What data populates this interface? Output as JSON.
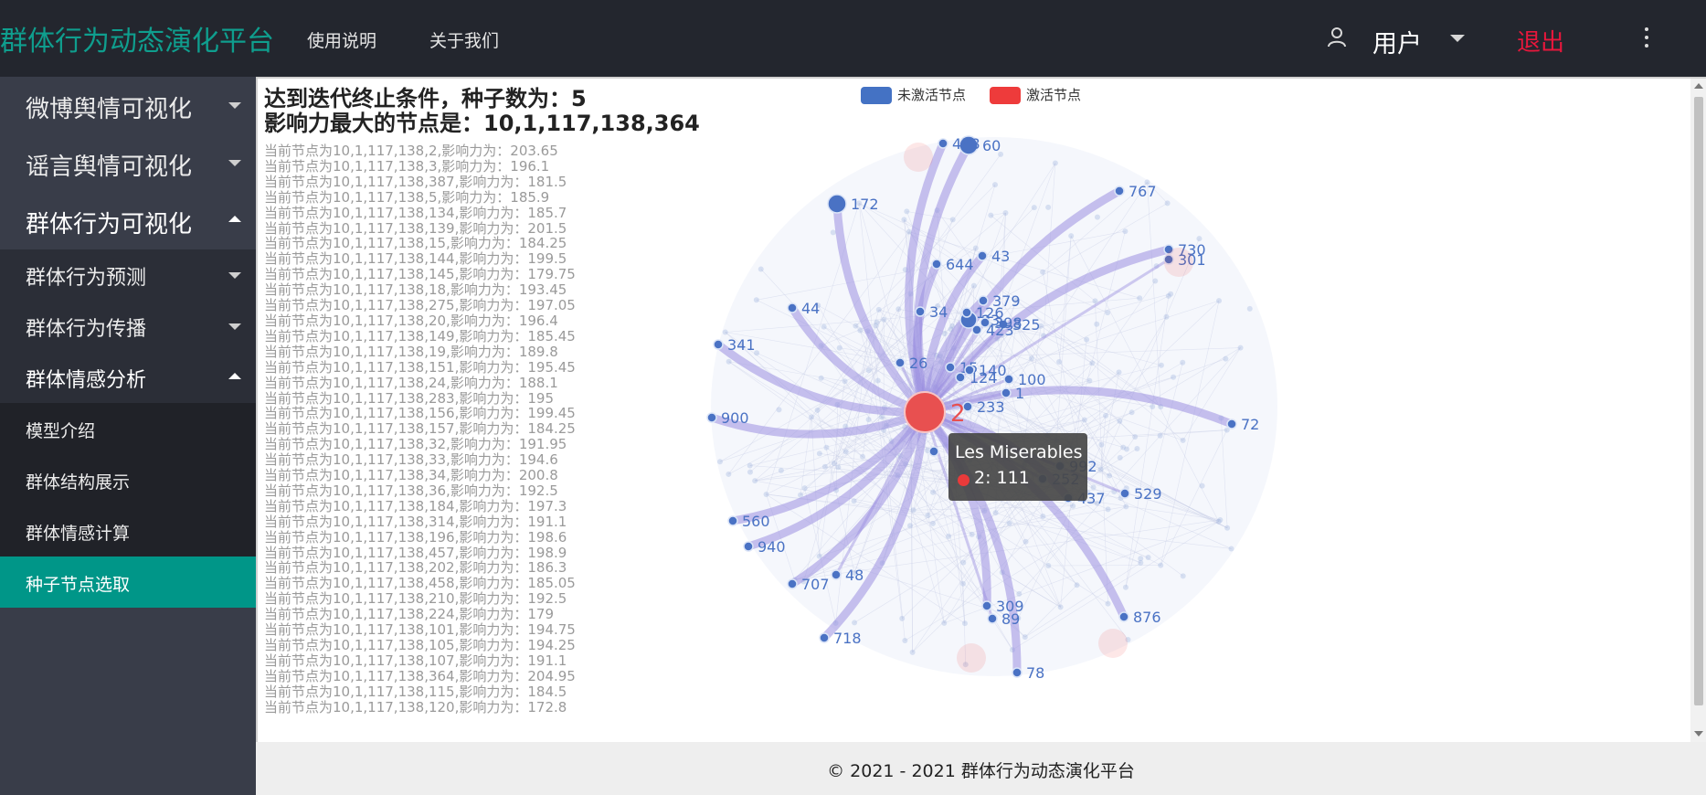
{
  "header": {
    "brand": "群体行为动态演化平台",
    "nav": [
      "使用说明",
      "关于我们"
    ],
    "user_label": "用户",
    "logout_label": "退出"
  },
  "sidebar": {
    "items": [
      {
        "label": "微博舆情可视化",
        "level": 1,
        "expanded": false
      },
      {
        "label": "谣言舆情可视化",
        "level": 1,
        "expanded": false
      },
      {
        "label": "群体行为可视化",
        "level": 1,
        "expanded": true
      },
      {
        "label": "群体行为预测",
        "level": 2,
        "expanded": false
      },
      {
        "label": "群体行为传播",
        "level": 2,
        "expanded": false
      },
      {
        "label": "群体情感分析",
        "level": 2,
        "expanded": true
      },
      {
        "label": "模型介绍",
        "level": 3
      },
      {
        "label": "群体结构展示",
        "level": 3
      },
      {
        "label": "群体情感计算",
        "level": 3
      },
      {
        "label": "种子节点选取",
        "level": 3,
        "active": true
      }
    ]
  },
  "result": {
    "line1": "达到迭代终止条件，种子数为：5",
    "line2": "影响力最大的节点是：10,1,117,138,364",
    "log": [
      "当前节点为10,1,117,138,2,影响力为：203.65",
      "当前节点为10,1,117,138,3,影响力为：196.1",
      "当前节点为10,1,117,138,387,影响力为：181.5",
      "当前节点为10,1,117,138,5,影响力为：185.9",
      "当前节点为10,1,117,138,134,影响力为：185.7",
      "当前节点为10,1,117,138,139,影响力为：201.5",
      "当前节点为10,1,117,138,15,影响力为：184.25",
      "当前节点为10,1,117,138,144,影响力为：199.5",
      "当前节点为10,1,117,138,145,影响力为：179.75",
      "当前节点为10,1,117,138,18,影响力为：193.45",
      "当前节点为10,1,117,138,275,影响力为：197.05",
      "当前节点为10,1,117,138,20,影响力为：196.4",
      "当前节点为10,1,117,138,149,影响力为：185.45",
      "当前节点为10,1,117,138,19,影响力为：189.8",
      "当前节点为10,1,117,138,151,影响力为：195.45",
      "当前节点为10,1,117,138,24,影响力为：188.1",
      "当前节点为10,1,117,138,283,影响力为：195",
      "当前节点为10,1,117,138,156,影响力为：199.45",
      "当前节点为10,1,117,138,157,影响力为：184.25",
      "当前节点为10,1,117,138,32,影响力为：191.95",
      "当前节点为10,1,117,138,33,影响力为：194.6",
      "当前节点为10,1,117,138,34,影响力为：200.8",
      "当前节点为10,1,117,138,36,影响力为：192.5",
      "当前节点为10,1,117,138,184,影响力为：197.3",
      "当前节点为10,1,117,138,314,影响力为：191.1",
      "当前节点为10,1,117,138,196,影响力为：198.6",
      "当前节点为10,1,117,138,457,影响力为：198.9",
      "当前节点为10,1,117,138,202,影响力为：186.3",
      "当前节点为10,1,117,138,458,影响力为：185.05",
      "当前节点为10,1,117,138,210,影响力为：192.5",
      "当前节点为10,1,117,138,224,影响力为：179",
      "当前节点为10,1,117,138,101,影响力为：194.75",
      "当前节点为10,1,117,138,105,影响力为：194.25",
      "当前节点为10,1,117,138,107,影响力为：191.1",
      "当前节点为10,1,117,138,364,影响力为：204.95",
      "当前节点为10,1,117,138,115,影响力为：184.5",
      "当前节点为10,1,117,138,120,影响力为：172.8"
    ]
  },
  "graph": {
    "legend": [
      {
        "label": "未激活节点",
        "color": "#4472c4"
      },
      {
        "label": "激活节点",
        "color": "#ee3b3b"
      }
    ],
    "center": {
      "label": "2",
      "color": "#e85050"
    },
    "visible_node_labels": [
      "458",
      "60",
      "172",
      "767",
      "730",
      "301",
      "644",
      "43",
      "379",
      "44",
      "34",
      "126",
      "23",
      "398",
      "325",
      "423",
      "341",
      "26",
      "15",
      "140",
      "124",
      "100",
      "1",
      "233",
      "900",
      "72",
      "992",
      "252",
      "437",
      "529",
      "560",
      "940",
      "48",
      "707",
      "309",
      "89",
      "876",
      "718",
      "78"
    ],
    "tooltip": {
      "title": "Les Miserables",
      "text": "2: 111",
      "dot_color": "#e93a3a"
    },
    "edge_color": "#9b8fe0"
  },
  "footer": {
    "text": "© 2021 - 2021 群体行为动态演化平台"
  }
}
